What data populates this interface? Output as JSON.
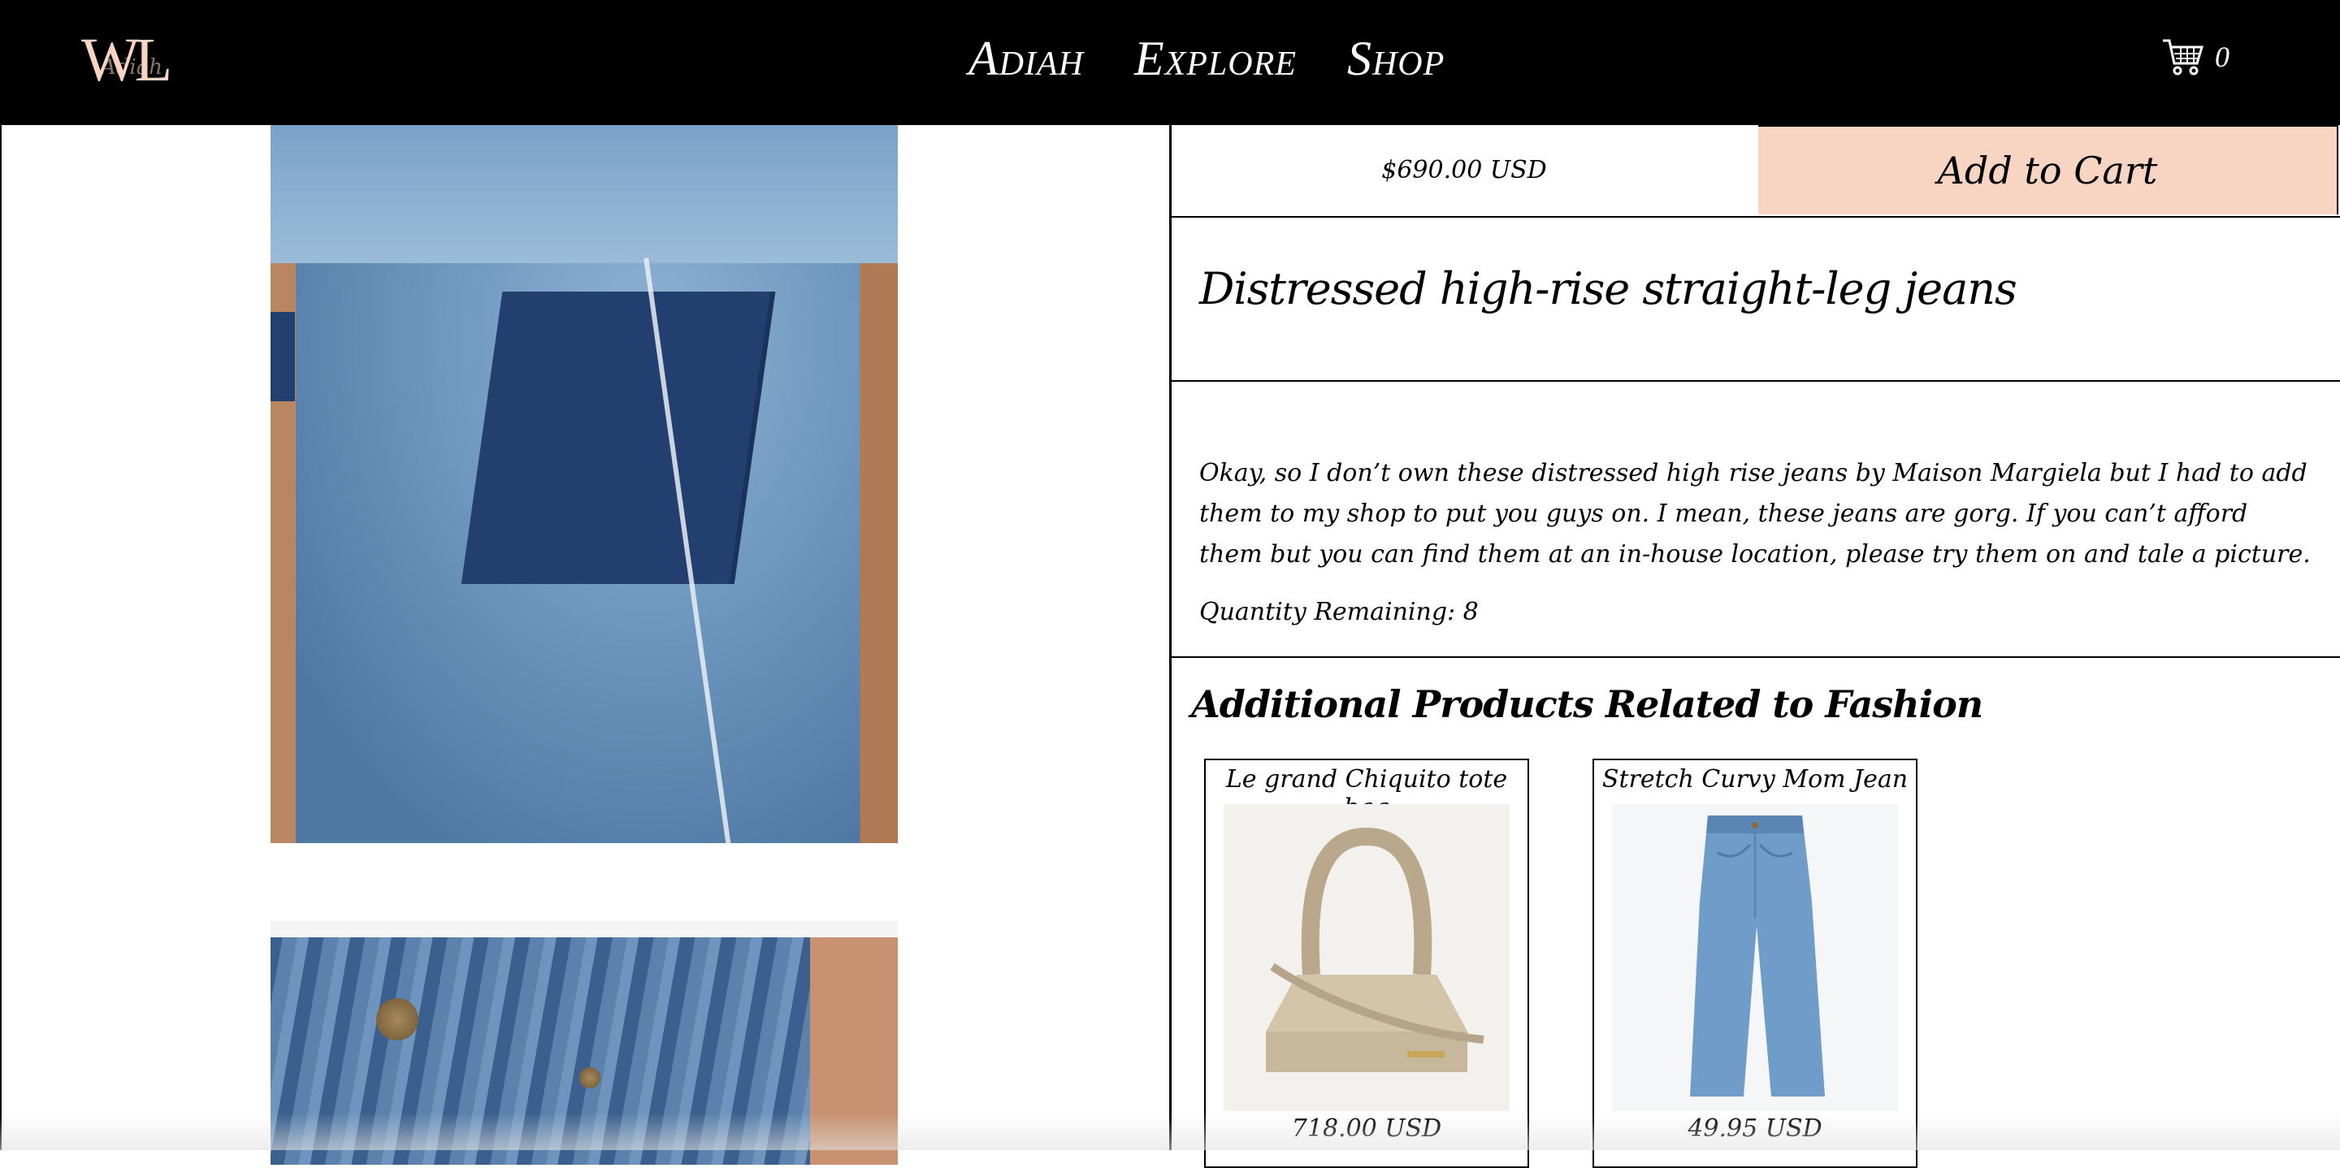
{
  "header": {
    "logo_text": "WL",
    "logo_script": "Adiah",
    "nav": [
      {
        "label": "Adiah"
      },
      {
        "label": "Explore"
      },
      {
        "label": "Shop"
      }
    ],
    "cart_count": "0",
    "cart_icon": "shopping-cart-icon"
  },
  "product": {
    "price": "$690.00 USD",
    "add_to_cart_label": "Add to Cart",
    "title": "Distressed high-rise straight-leg jeans",
    "description": "Okay, so I don’t own these distressed high rise jeans by Maison Margiela but I had to add them to my shop to put you guys on. I mean, these jeans are gorg. If you can’t afford them but you can find them at an in-house location, please try them on and tale a picture.",
    "quantity_text": "Quantity Remaining: 8"
  },
  "related": {
    "heading": "Additional Products Related to Fashion",
    "items": [
      {
        "name": "Le grand Chiquito tote bag",
        "price": "718.00 USD"
      },
      {
        "name": "Stretch Curvy Mom Jean",
        "price": "49.95 USD"
      }
    ]
  },
  "colors": {
    "header_bg": "#000000",
    "accent_peach": "#f8d5c3",
    "logo": "#f6d3c2"
  }
}
